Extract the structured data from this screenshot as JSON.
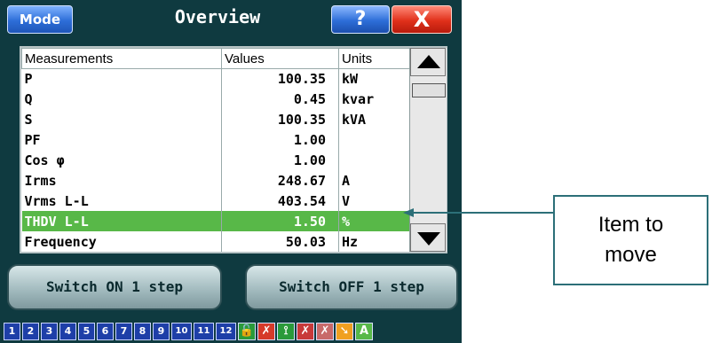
{
  "window": {
    "mode_label": "Mode",
    "title": "Overview",
    "help_label": "?",
    "close_label": "X"
  },
  "table": {
    "headers": [
      "Measurements",
      "Values",
      "Units"
    ],
    "rows": [
      {
        "name": "P",
        "value": "100.35",
        "unit": "kW"
      },
      {
        "name": "Q",
        "value": "0.45",
        "unit": "kvar"
      },
      {
        "name": "S",
        "value": "100.35",
        "unit": "kVA"
      },
      {
        "name": "PF",
        "value": "1.00",
        "unit": ""
      },
      {
        "name": "Cos φ",
        "value": "1.00",
        "unit": ""
      },
      {
        "name": "Irms",
        "value": "248.67",
        "unit": "A"
      },
      {
        "name": "Vrms L-L",
        "value": "403.54",
        "unit": "V"
      },
      {
        "name": "THDV L-L",
        "value": "1.50",
        "unit": "%"
      },
      {
        "name": "Frequency",
        "value": "50.03",
        "unit": "Hz"
      }
    ],
    "selected_row": 7,
    "selected_color": "#58b848"
  },
  "actions": {
    "switch_on": "Switch ON 1 step",
    "switch_off": "Switch OFF 1 step"
  },
  "status_strip": {
    "steps": [
      "1",
      "2",
      "3",
      "4",
      "5",
      "6",
      "7",
      "8",
      "9",
      "10",
      "11",
      "12"
    ],
    "icons": [
      {
        "name": "lock-icon",
        "glyph": "🔓",
        "color": "#2a9a3a"
      },
      {
        "name": "fault-icon",
        "glyph": "✗",
        "color": "#d63a2a"
      },
      {
        "name": "temperature-icon",
        "glyph": "⟟",
        "color": "#2a9a3a"
      },
      {
        "name": "warning-icon",
        "glyph": "✗",
        "color": "#c83a3a"
      },
      {
        "name": "disabled-icon",
        "glyph": "✗",
        "color": "#c86a6a"
      },
      {
        "name": "arrow-icon",
        "glyph": "➘",
        "color": "#f0a020"
      },
      {
        "name": "alarm-icon",
        "glyph": "A",
        "color": "#58b848"
      }
    ]
  },
  "callout": {
    "text_line1": "Item to",
    "text_line2": "move"
  },
  "colors": {
    "panel_bg": "#0f3a40",
    "callout_border": "#2c6f78"
  }
}
